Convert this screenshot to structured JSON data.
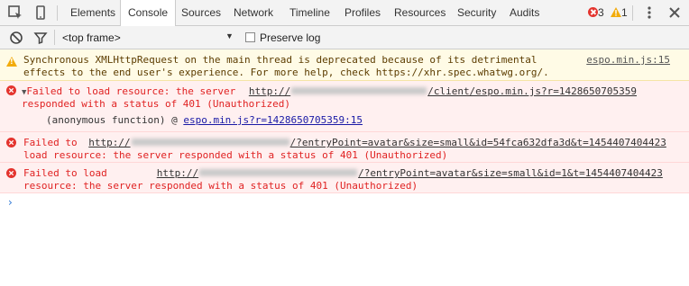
{
  "tabs": [
    "Elements",
    "Console",
    "Sources",
    "Network",
    "Timeline",
    "Profiles",
    "Resources",
    "Security",
    "Audits"
  ],
  "status": {
    "errors": "3",
    "warnings": "1"
  },
  "toolbar": {
    "frame": "<top frame>",
    "preserve_log": "Preserve log"
  },
  "messages": {
    "warning": {
      "line1": "Synchronous XMLHttpRequest on the main thread is deprecated because of its detrimental",
      "line2": "effects to the end user's experience. For more help, check https://xhr.spec.whatwg.org/.",
      "source": "espo.min.js:15"
    },
    "error1": {
      "prefix": "Failed to load resource: the server ",
      "url_start": "http://",
      "url_end": "/client/espo.min.js?r=1428650705359",
      "line2": "responded with a status of 401 (Unauthorized)",
      "stack_label": "(anonymous function) @ ",
      "stack_link": "espo.min.js?r=1428650705359:15"
    },
    "error2": {
      "prefix": "Failed to ",
      "url_start": "http://",
      "url_end": "/?entryPoint=avatar&size=small&id=54fca632dfa3d&t=1454407404423",
      "line2": "load resource: the server responded with a status of 401 (Unauthorized)"
    },
    "error3": {
      "prefix": "Failed to load",
      "url_start": "http://",
      "url_end": "/?entryPoint=avatar&size=small&id=1&t=1454407404423",
      "line2": "resource: the server responded with a status of 401 (Unauthorized)"
    }
  },
  "prompt_symbol": "›",
  "colors": {
    "error": "#e02222",
    "warning": "#f2ab0b",
    "link": "#1a1aa6",
    "prompt": "#2d76d4"
  }
}
